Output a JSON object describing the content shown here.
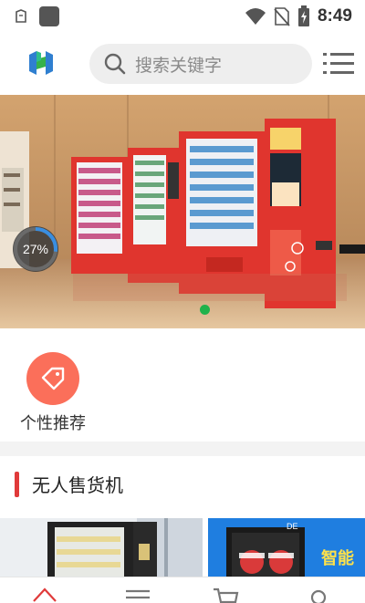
{
  "status_bar": {
    "time": "8:49",
    "icons": [
      "notification-icon",
      "app-icon",
      "wifi-icon",
      "no-sim-icon",
      "battery-charging-icon"
    ]
  },
  "header": {
    "logo": "app-logo",
    "search_placeholder": "搜索关键字",
    "menu_icon": "list-menu-icon"
  },
  "banner": {
    "progress_percent": 27,
    "progress_label": "27%",
    "active_slide": 1,
    "slide_count": 1
  },
  "quick_links": [
    {
      "label": "个性推荐",
      "icon": "tag-icon",
      "color": "#fb6f5a"
    }
  ],
  "section": {
    "title": "无人售货机",
    "accent": "#e03a3a"
  },
  "thumbnails": [
    {
      "caption": ""
    },
    {
      "caption": "智能",
      "tag": "DE"
    }
  ],
  "tabbar": {
    "items": [
      "home-icon",
      "list-icon",
      "cart-icon",
      "profile-icon"
    ],
    "active_color": "#e03a3a"
  }
}
